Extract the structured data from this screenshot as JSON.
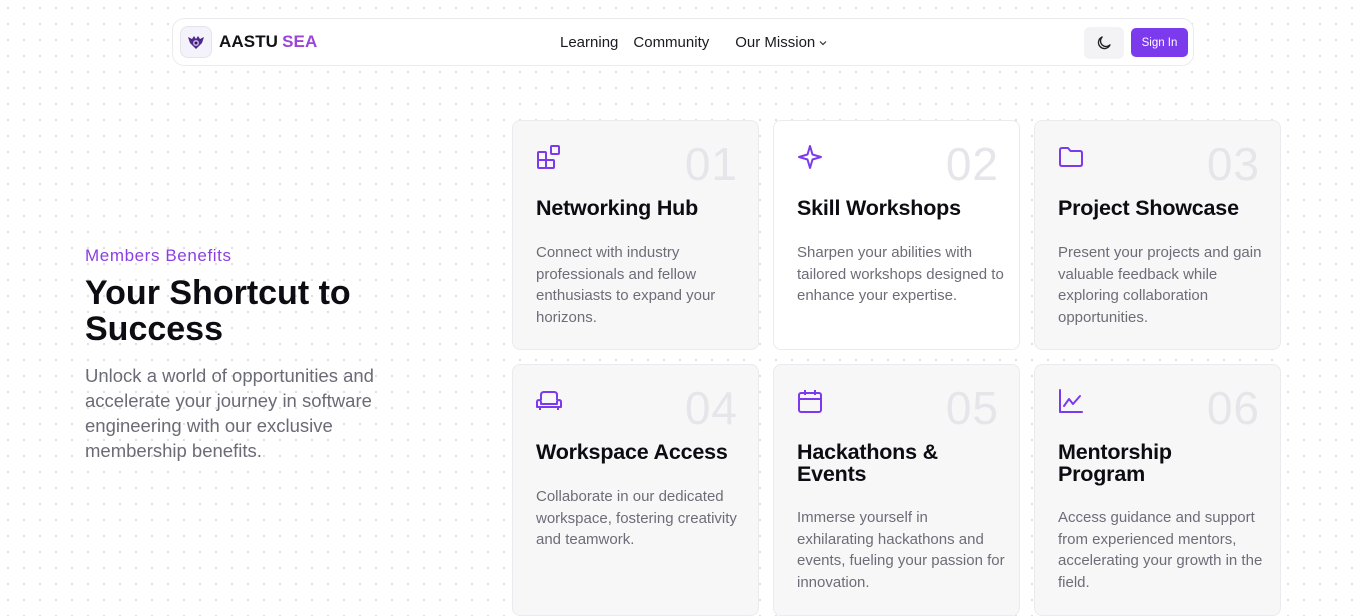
{
  "brand": {
    "name_part1": "AASTU",
    "name_part2": "SEA"
  },
  "nav": {
    "links": [
      "Learning",
      "Community"
    ],
    "mission_label": "Our Mission",
    "sign_in_label": "Sign In"
  },
  "hero": {
    "eyebrow": "Members Benefits",
    "title": "Your Shortcut to Success",
    "description": "Unlock a world of opportunities and accelerate your journey in software engineering with our exclusive membership benefits."
  },
  "cards": [
    {
      "num": "01",
      "icon": "blocks-icon",
      "title": "Networking Hub",
      "desc": "Connect with industry professionals and fellow enthusiasts to expand your horizons."
    },
    {
      "num": "02",
      "icon": "sparkle-icon",
      "title": "Skill Workshops",
      "desc": "Sharpen your abilities with tailored workshops designed to enhance your expertise."
    },
    {
      "num": "03",
      "icon": "folder-icon",
      "title": "Project Showcase",
      "desc": "Present your projects and gain valuable feedback while exploring collaboration opportunities."
    },
    {
      "num": "04",
      "icon": "sofa-icon",
      "title": "Workspace Access",
      "desc": "Collaborate in our dedicated workspace, fostering creativity and teamwork."
    },
    {
      "num": "05",
      "icon": "calendar-icon",
      "title": "Hackathons & Events",
      "desc": "Immerse yourself in exhilarating hackathons and events, fueling your passion for innovation."
    },
    {
      "num": "06",
      "icon": "chart-line-icon",
      "title": "Mentorship Program",
      "desc": "Access guidance and support from experienced mentors, accelerating your growth in the field."
    }
  ],
  "colors": {
    "accent": "#7c3aed",
    "eyebrow": "#8b3fe0",
    "brand_accent": "#9b45d8"
  }
}
